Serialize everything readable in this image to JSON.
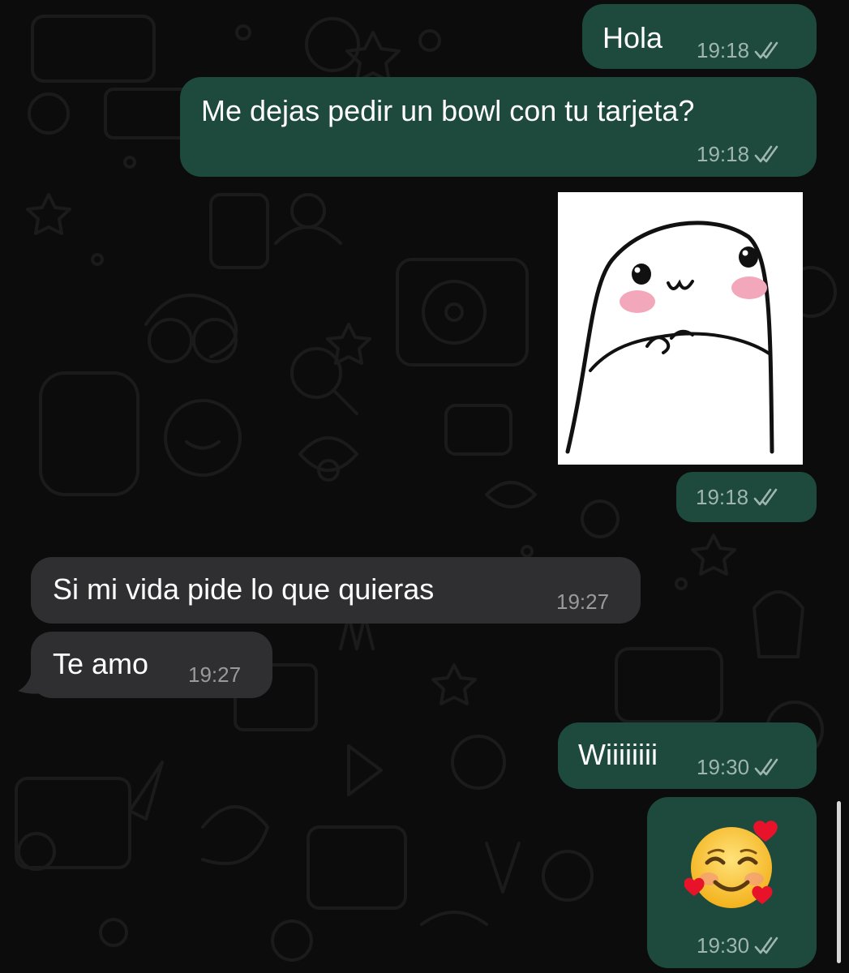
{
  "conversation": {
    "messages": [
      {
        "direction": "outgoing",
        "text": "Hola",
        "time": "19:18",
        "status": "read"
      },
      {
        "direction": "outgoing",
        "text": "Me dejas pedir un bowl con tu tarjeta?",
        "time": "19:18",
        "status": "read"
      },
      {
        "direction": "outgoing",
        "type": "sticker",
        "sticker_icon": "shy-blob-sticker",
        "time": "19:18",
        "status": "read"
      },
      {
        "direction": "incoming",
        "text": "Si mi vida pide lo que quieras",
        "time": "19:27"
      },
      {
        "direction": "incoming",
        "text": "Te amo",
        "time": "19:27"
      },
      {
        "direction": "outgoing",
        "text": "Wiiiiiiii",
        "time": "19:30",
        "status": "read"
      },
      {
        "direction": "outgoing",
        "type": "emoji",
        "emoji_icon": "smiling-face-with-hearts-emoji",
        "time": "19:30",
        "status": "read"
      }
    ]
  },
  "colors": {
    "background": "#0c0c0c",
    "outgoing_bubble": "#1d4a3d",
    "incoming_bubble": "#2f2f31",
    "read_ticks": "#9fb5ad"
  }
}
